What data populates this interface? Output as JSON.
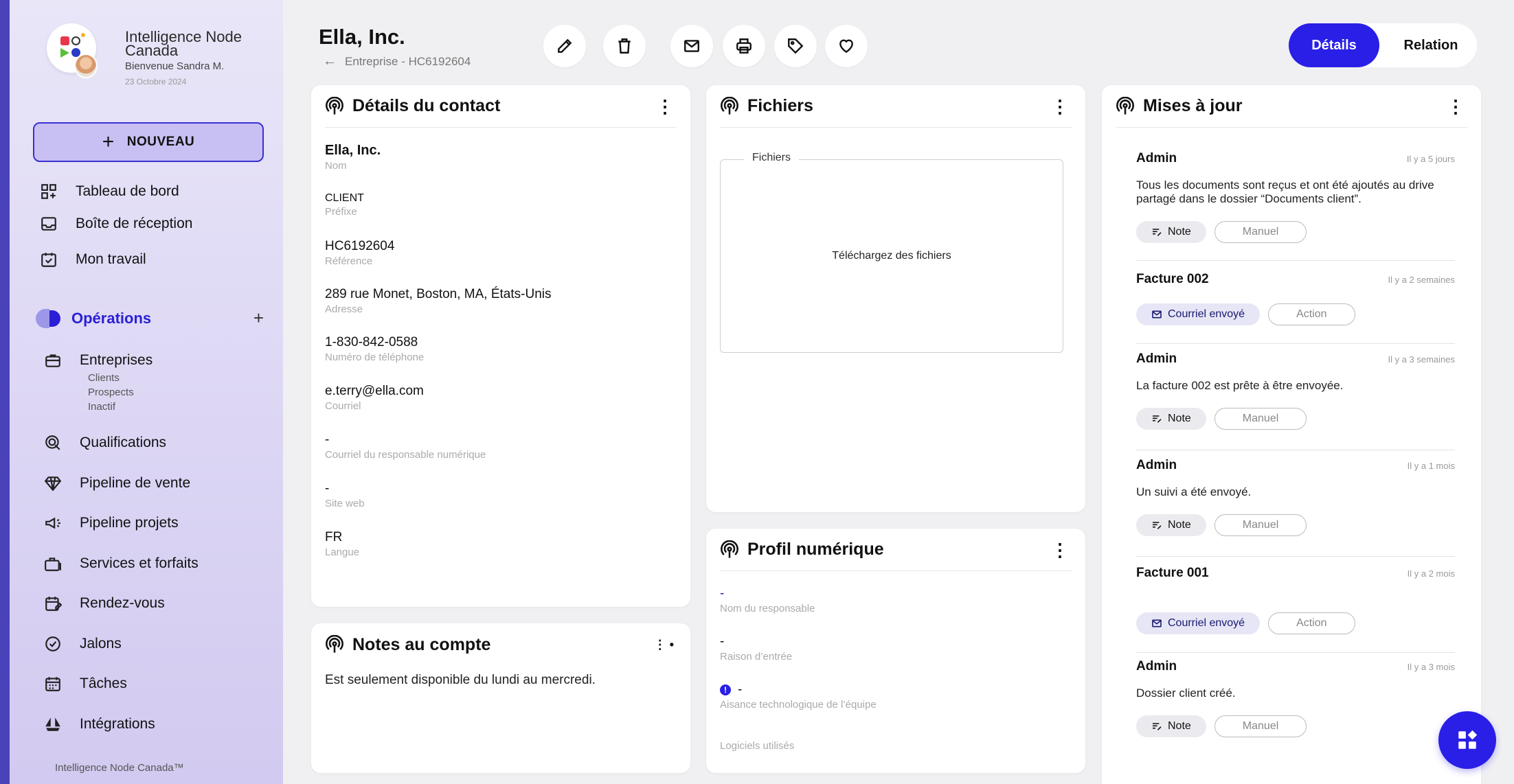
{
  "org": {
    "name": "Intelligence Node Canada",
    "welcome": "Bienvenue Sandra M.",
    "date": "23 Octobre 2024",
    "footer": "Intelligence Node Canada™"
  },
  "sidebar": {
    "new_label": "NOUVEAU",
    "top_items": [
      {
        "label": "Tableau de bord",
        "icon": "dashboard-icon"
      },
      {
        "label": "Boîte de réception",
        "icon": "inbox-icon"
      },
      {
        "label": "Mon travail",
        "icon": "calendar-check-icon"
      }
    ],
    "section": {
      "title": "Opérations"
    },
    "entreprises": {
      "label": "Entreprises",
      "subs": [
        "Clients",
        "Prospects",
        "Inactif"
      ]
    },
    "items": [
      {
        "label": "Qualifications",
        "icon": "qualifications-icon"
      },
      {
        "label": "Pipeline de vente",
        "icon": "diamond-icon"
      },
      {
        "label": "Pipeline projets",
        "icon": "megaphone-icon"
      },
      {
        "label": "Services et forfaits",
        "icon": "briefcase-icon"
      },
      {
        "label": "Rendez-vous",
        "icon": "calendar-edit-icon"
      },
      {
        "label": "Jalons",
        "icon": "check-circle-icon"
      },
      {
        "label": "Tâches",
        "icon": "calendar-icon"
      },
      {
        "label": "Intégrations",
        "icon": "integrations-icon"
      }
    ]
  },
  "header": {
    "title": "Ella, Inc.",
    "crumb": "Entreprise - HC6192604",
    "tabs": {
      "active": "Détails",
      "other": "Relation"
    }
  },
  "contact": {
    "title": "Détails du contact",
    "name": {
      "v": "Ella, Inc.",
      "l": "Nom"
    },
    "fields": [
      {
        "v": "CLIENT",
        "l": "Préfixe"
      },
      {
        "v": "HC6192604",
        "l": "Référence"
      },
      {
        "v": "289 rue Monet, Boston, MA, États-Unis",
        "l": "Adresse"
      },
      {
        "v": "1-830-842-0588",
        "l": "Numéro de téléphone"
      },
      {
        "v": "e.terry@ella.com",
        "l": "Courriel"
      },
      {
        "v": "-",
        "l": "Courriel du responsable numérique"
      },
      {
        "v": "-",
        "l": "Site web"
      },
      {
        "v": "FR",
        "l": "Langue"
      }
    ]
  },
  "notes": {
    "title": "Notes au compte",
    "text": "Est seulement disponible du lundi au mercredi."
  },
  "files": {
    "title": "Fichiers",
    "legend": "Fichiers",
    "upload": "Téléchargez des fichiers"
  },
  "profile": {
    "title": "Profil numérique",
    "fields": [
      {
        "v": "-",
        "l": "Nom du responsable"
      },
      {
        "v": "-",
        "l": "Raison d’entrée"
      },
      {
        "v": "-",
        "l": "Aisance technologique de l’équipe"
      },
      {
        "v": "",
        "l": "Logiciels utilisés"
      }
    ]
  },
  "updates": {
    "title": "Mises à jour",
    "items": [
      {
        "who": "Admin",
        "when": "Il y a 5 jours",
        "msg": "Tous les documents sont reçus et ont été ajoutés au drive partagé dans le dossier “Documents client”.",
        "tag": "Note",
        "tag2": "Manuel",
        "kind": "note"
      },
      {
        "who": "Facture 002",
        "when": "Il y a 2 semaines",
        "msg": "",
        "tag": "Courriel envoyé",
        "tag2": "Action",
        "kind": "mail"
      },
      {
        "who": "Admin",
        "when": "Il y a 3 semaines",
        "msg": "La facture 002 est prête à être envoyée.",
        "tag": "Note",
        "tag2": "Manuel",
        "kind": "note"
      },
      {
        "who": "Admin",
        "when": "Il y a 1 mois",
        "msg": "Un suivi a été envoyé.",
        "tag": "Note",
        "tag2": "Manuel",
        "kind": "note"
      },
      {
        "who": "Facture 001",
        "when": "Il y a 2 mois",
        "msg": "",
        "tag": "Courriel envoyé",
        "tag2": "Action",
        "kind": "mail"
      },
      {
        "who": "Admin",
        "when": "Il y a 3 mois",
        "msg": "Dossier client créé.",
        "tag": "Note",
        "tag2": "Manuel",
        "kind": "note"
      }
    ]
  },
  "colors": {
    "accent": "#2a1fe6",
    "sidebar_border": "#4a42b8"
  }
}
